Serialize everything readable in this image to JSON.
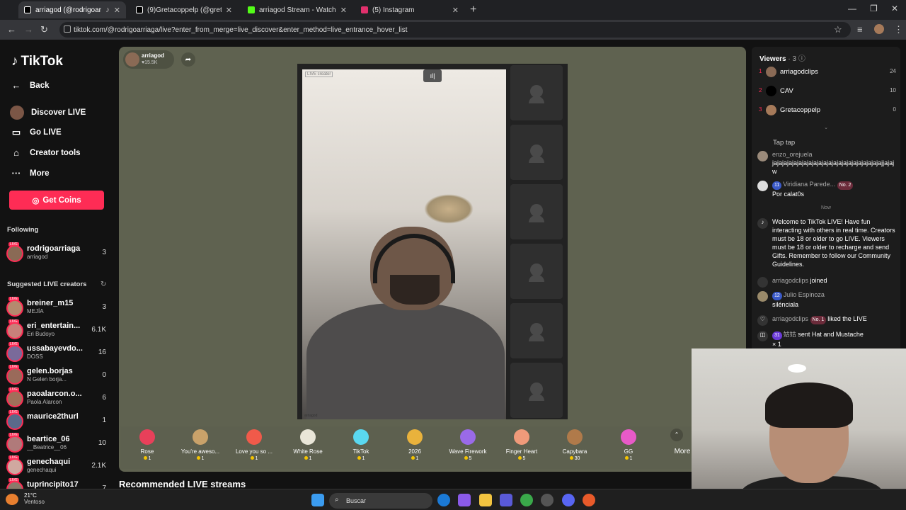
{
  "tabs": [
    {
      "title": "arriagod (@rodrigoarriaga",
      "fav_color": "#111111",
      "active": true
    },
    {
      "title": "(9)Gretacoppelp (@gretacoppe",
      "fav_color": "#111111",
      "active": false
    },
    {
      "title": "arriagod Stream - Watch Live o",
      "fav_color": "#53fc18",
      "active": false
    },
    {
      "title": "(5) Instagram",
      "fav_color": "#e1306c",
      "active": false
    }
  ],
  "address": {
    "url": "tiktok.com/@rodrigoarriaga/live?enter_from_merge=live_discover&enter_method=live_entrance_hover_list"
  },
  "sidebar": {
    "logo": "TikTok",
    "nav": [
      {
        "label": "Back",
        "icon": "arrow-left-icon"
      },
      {
        "label": "Discover LIVE",
        "icon": "avatar-icon"
      },
      {
        "label": "Go LIVE",
        "icon": "video-camera-icon"
      },
      {
        "label": "Creator tools",
        "icon": "home-icon"
      },
      {
        "label": "More",
        "icon": "ellipsis-icon"
      }
    ],
    "coins_label": "Get Coins",
    "following_title": "Following",
    "following": [
      {
        "name": "rodrigoarriaga",
        "sub": "arriagod",
        "count": "3"
      }
    ],
    "suggested_title": "Suggested LIVE creators",
    "suggested": [
      {
        "name": "breiner_m15",
        "sub": "MEJÍA",
        "count": "3"
      },
      {
        "name": "eri_entertain...",
        "sub": "Eri Budoyo",
        "count": "6.1K"
      },
      {
        "name": "ussabayevdo...",
        "sub": "DOSS",
        "count": "16"
      },
      {
        "name": "gelen.borjas",
        "sub": "N Gelen borja...",
        "count": "0"
      },
      {
        "name": "paoalarcon.o...",
        "sub": "Paola Alarcon",
        "count": "6"
      },
      {
        "name": "maurice2thurl",
        "sub": "",
        "count": "1"
      },
      {
        "name": "beartice_06",
        "sub": "__Beatrice__06",
        "count": "10"
      },
      {
        "name": "genechaqui",
        "sub": "genechaqui",
        "count": "2.1K"
      },
      {
        "name": "tuprincipito17",
        "sub": "",
        "count": "7"
      }
    ]
  },
  "host": {
    "name": "arriagod",
    "likes": "15.5K"
  },
  "stream": {
    "tag": "LIVE creator",
    "watermark": "arriagod"
  },
  "gifts": [
    {
      "name": "Rose",
      "price": "1",
      "color": "#e8405a"
    },
    {
      "name": "You're aweso...",
      "price": "1",
      "color": "#c9a26a"
    },
    {
      "name": "Love you so ...",
      "price": "1",
      "color": "#f05a4a"
    },
    {
      "name": "White Rose",
      "price": "1",
      "color": "#e9e6d8"
    },
    {
      "name": "TikTok",
      "price": "1",
      "color": "#5ad8f0"
    },
    {
      "name": "2026",
      "price": "1",
      "color": "#e9b23c"
    },
    {
      "name": "Wave Firework",
      "price": "5",
      "color": "#9a6ae8"
    },
    {
      "name": "Finger Heart",
      "price": "5",
      "color": "#f09a7a"
    },
    {
      "name": "Capybara",
      "price": "30",
      "color": "#b07a4a"
    },
    {
      "name": "GG",
      "price": "1",
      "color": "#e85ac8"
    }
  ],
  "gifts_more": "More",
  "recommended_title": "Recommended LIVE streams",
  "viewers": {
    "title": "Viewers",
    "count": "· 3",
    "list": [
      {
        "rank": "1",
        "name": "arriagodclips",
        "score": "24",
        "color": "#8a6a55"
      },
      {
        "rank": "2",
        "name": "CAV",
        "score": "10",
        "color": "#000000"
      },
      {
        "rank": "3",
        "name": "Gretacoppelp",
        "score": "0",
        "color": "#a67a5a"
      }
    ]
  },
  "chat": {
    "tap": "Tap tap",
    "now_label": "Now",
    "m1_user": "enzo_orejuela",
    "m1_text": "jajajajajajajajajajajajajajajajajajajajajajajjajajw",
    "m2_level": "11",
    "m2_user": "Viridiana Parede...",
    "m2_badge": "No. 2",
    "m2_text": "Por calat0s",
    "welcome": "Welcome to TikTok LIVE! Have fun interacting with others in real time. Creators must be 18 or older to go LIVE. Viewers must be 18 or older to recharge and send Gifts. Remember to follow our Community Guidelines.",
    "join_user": "arriagodclips",
    "join_text": "joined",
    "m3_level": "12",
    "m3_user": "Julio Espinoza",
    "m3_text": "silénciala",
    "like_user": "arriagodclips",
    "like_badge": "No. 1",
    "like_text": "liked the LIVE",
    "gift_level": "31",
    "gift_user": "姑姑",
    "gift_text": "sent Hat and Mustache",
    "gift_count": "× 1"
  },
  "taskbar": {
    "temp": "21°C",
    "cond": "Ventoso",
    "search": "Buscar"
  }
}
